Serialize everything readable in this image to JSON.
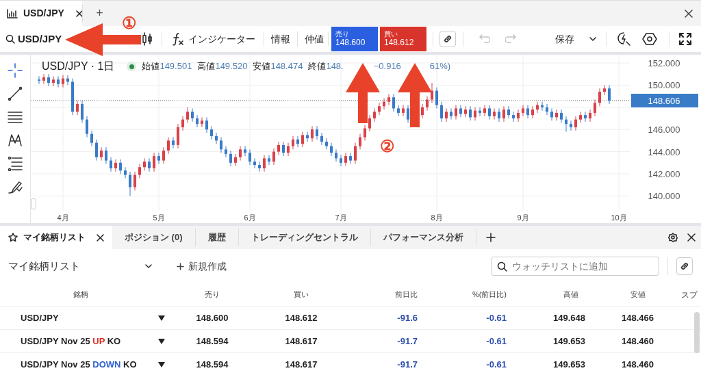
{
  "chart_tabs": [
    {
      "label": "USD/JPY",
      "selected": true
    },
    {
      "label": "+",
      "selected": false
    }
  ],
  "toolbar": {
    "search": "USD/JPY",
    "indicator": "インジケーター",
    "info": "情報",
    "mid": "仲値",
    "sell": {
      "label": "売り",
      "price": "148.600"
    },
    "buy": {
      "label": "買い",
      "price": "148.612"
    },
    "undo_disabled": true,
    "redo_disabled": true,
    "save": "保存"
  },
  "chart": {
    "title": "USD/JPY · 1日",
    "live": true,
    "ohlc": [
      {
        "label": "始値",
        "value": "149.501"
      },
      {
        "label": "高値",
        "value": "149.520"
      },
      {
        "label": "安値",
        "value": "148.474"
      },
      {
        "label": "終値",
        "value": "148."
      }
    ],
    "change": "−0.916",
    "change_pct": "61%)",
    "chart_data": {
      "type": "candlestick",
      "categories": [
        null,
        null,
        null,
        null,
        null,
        "4月",
        null,
        null,
        null,
        null,
        null,
        null,
        null,
        null,
        null,
        null,
        null,
        null,
        null,
        null,
        null,
        null,
        null,
        null,
        null,
        "5月",
        null,
        null,
        null,
        null,
        null,
        null,
        null,
        null,
        null,
        null,
        null,
        null,
        null,
        null,
        null,
        null,
        null,
        null,
        "6月",
        null,
        null,
        null,
        null,
        null,
        null,
        null,
        null,
        null,
        null,
        null,
        null,
        null,
        null,
        null,
        null,
        null,
        null,
        "7月",
        null,
        null,
        null,
        null,
        null,
        null,
        null,
        null,
        null,
        null,
        null,
        null,
        null,
        null,
        null,
        null,
        null,
        null,
        null,
        "8月",
        null,
        null,
        null,
        null,
        null,
        null,
        null,
        null,
        null,
        null,
        null,
        null,
        null,
        null,
        null,
        null,
        null,
        "9月",
        null,
        null,
        null,
        null,
        null,
        null,
        null,
        null,
        null,
        null,
        null,
        null,
        null,
        null,
        null,
        null,
        null,
        null,
        null,
        "10月"
      ],
      "ohlc": [
        [
          150.5,
          150.8,
          150.1,
          150.4
        ],
        [
          150.4,
          151.0,
          150.1,
          150.7
        ],
        [
          150.7,
          151.0,
          149.9,
          150.2
        ],
        [
          150.2,
          150.8,
          149.9,
          150.5
        ],
        [
          150.5,
          150.8,
          149.8,
          150.1
        ],
        [
          150.1,
          150.9,
          149.8,
          150.6
        ],
        [
          150.6,
          150.9,
          150.0,
          150.3
        ],
        [
          150.3,
          150.6,
          147.3,
          147.6
        ],
        [
          147.6,
          148.6,
          147.3,
          148.3
        ],
        [
          148.3,
          148.6,
          146.6,
          146.9
        ],
        [
          146.9,
          147.2,
          145.3,
          145.6
        ],
        [
          145.6,
          145.9,
          144.5,
          144.8
        ],
        [
          144.8,
          145.1,
          143.2,
          143.5
        ],
        [
          143.5,
          144.4,
          143.2,
          144.1
        ],
        [
          144.1,
          144.4,
          142.9,
          143.2
        ],
        [
          143.2,
          143.5,
          142.2,
          142.5
        ],
        [
          142.5,
          143.3,
          142.2,
          143.0
        ],
        [
          143.0,
          143.3,
          142.0,
          142.3
        ],
        [
          142.3,
          142.6,
          141.6,
          141.9
        ],
        [
          141.9,
          142.2,
          140.0,
          140.8
        ],
        [
          140.8,
          142.2,
          140.5,
          141.9
        ],
        [
          141.9,
          142.9,
          141.6,
          142.6
        ],
        [
          142.6,
          143.4,
          142.3,
          143.1
        ],
        [
          143.1,
          143.4,
          142.2,
          142.5
        ],
        [
          142.5,
          143.9,
          142.2,
          143.6
        ],
        [
          143.6,
          143.9,
          142.9,
          143.2
        ],
        [
          143.2,
          144.4,
          142.9,
          144.1
        ],
        [
          144.1,
          145.3,
          143.8,
          145.0
        ],
        [
          145.0,
          145.3,
          144.3,
          144.6
        ],
        [
          144.6,
          146.5,
          144.3,
          146.2
        ],
        [
          146.2,
          147.2,
          145.9,
          146.9
        ],
        [
          146.9,
          148.0,
          146.6,
          147.6
        ],
        [
          147.6,
          147.9,
          146.7,
          147.0
        ],
        [
          147.0,
          147.3,
          146.2,
          146.5
        ],
        [
          146.5,
          147.1,
          146.2,
          146.8
        ],
        [
          146.8,
          147.1,
          145.7,
          146.0
        ],
        [
          146.0,
          146.3,
          145.1,
          145.4
        ],
        [
          145.4,
          145.7,
          144.7,
          145.0
        ],
        [
          145.0,
          145.3,
          143.9,
          144.2
        ],
        [
          144.2,
          144.5,
          143.5,
          143.8
        ],
        [
          143.8,
          144.1,
          142.7,
          143.0
        ],
        [
          143.0,
          143.8,
          142.7,
          143.5
        ],
        [
          143.5,
          144.5,
          143.2,
          144.2
        ],
        [
          144.2,
          144.5,
          143.6,
          143.9
        ],
        [
          143.9,
          144.2,
          142.8,
          143.1
        ],
        [
          143.1,
          143.4,
          142.5,
          142.8
        ],
        [
          142.8,
          143.1,
          142.2,
          142.5
        ],
        [
          142.5,
          143.7,
          142.2,
          143.4
        ],
        [
          143.4,
          143.7,
          142.8,
          143.1
        ],
        [
          143.1,
          144.3,
          142.8,
          144.0
        ],
        [
          144.0,
          144.9,
          143.7,
          144.6
        ],
        [
          144.6,
          144.9,
          143.6,
          143.9
        ],
        [
          143.9,
          144.8,
          143.6,
          144.5
        ],
        [
          144.5,
          145.4,
          144.2,
          145.1
        ],
        [
          145.1,
          145.4,
          144.4,
          144.7
        ],
        [
          144.7,
          145.8,
          144.4,
          145.5
        ],
        [
          145.5,
          145.8,
          144.9,
          145.2
        ],
        [
          145.2,
          146.3,
          144.9,
          146.0
        ],
        [
          146.0,
          146.3,
          145.1,
          145.4
        ],
        [
          145.4,
          145.7,
          144.6,
          144.9
        ],
        [
          144.9,
          145.2,
          144.2,
          144.5
        ],
        [
          144.5,
          144.8,
          143.6,
          143.9
        ],
        [
          143.9,
          144.2,
          143.1,
          143.4
        ],
        [
          143.4,
          143.7,
          142.7,
          143.0
        ],
        [
          143.0,
          143.9,
          142.7,
          143.6
        ],
        [
          143.6,
          143.9,
          142.9,
          143.2
        ],
        [
          143.2,
          144.8,
          142.9,
          144.5
        ],
        [
          144.5,
          145.6,
          144.2,
          145.3
        ],
        [
          145.3,
          146.4,
          145.0,
          146.1
        ],
        [
          146.1,
          147.3,
          145.8,
          147.0
        ],
        [
          147.0,
          147.9,
          146.7,
          147.6
        ],
        [
          147.6,
          148.4,
          147.3,
          148.1
        ],
        [
          148.1,
          148.8,
          147.8,
          148.5
        ],
        [
          148.5,
          149.2,
          148.2,
          148.9
        ],
        [
          148.9,
          149.2,
          147.6,
          147.9
        ],
        [
          147.9,
          148.2,
          147.2,
          147.5
        ],
        [
          147.5,
          148.2,
          147.2,
          147.9
        ],
        [
          147.9,
          148.2,
          146.6,
          146.9
        ],
        null,
        null,
        [
          147.3,
          148.3,
          147.0,
          148.0
        ],
        [
          148.0,
          149.0,
          147.7,
          148.7
        ],
        [
          148.7,
          150.2,
          148.4,
          149.5
        ],
        [
          149.5,
          149.8,
          147.9,
          148.2
        ],
        [
          148.2,
          148.5,
          146.7,
          147.0
        ],
        [
          147.0,
          147.9,
          146.7,
          147.6
        ],
        [
          147.6,
          147.9,
          146.9,
          147.2
        ],
        [
          147.2,
          148.2,
          146.9,
          147.9
        ],
        [
          147.9,
          148.2,
          147.1,
          147.4
        ],
        [
          147.4,
          148.1,
          147.1,
          147.8
        ],
        [
          147.8,
          148.1,
          146.8,
          147.1
        ],
        [
          147.1,
          148.0,
          146.8,
          147.7
        ],
        [
          147.7,
          148.0,
          147.2,
          147.5
        ],
        [
          147.5,
          148.2,
          147.2,
          147.9
        ],
        [
          147.9,
          148.2,
          146.9,
          147.2
        ],
        [
          147.2,
          147.9,
          146.9,
          147.6
        ],
        [
          147.6,
          147.9,
          146.7,
          147.0
        ],
        [
          147.0,
          148.1,
          146.7,
          147.8
        ],
        [
          147.8,
          148.1,
          147.0,
          147.3
        ],
        [
          147.3,
          147.6,
          146.7,
          147.0
        ],
        [
          147.0,
          147.8,
          146.7,
          147.5
        ],
        [
          147.5,
          148.2,
          147.2,
          147.9
        ],
        [
          147.9,
          148.2,
          147.0,
          147.3
        ],
        [
          147.3,
          148.1,
          147.0,
          147.8
        ],
        [
          147.8,
          148.5,
          147.5,
          148.2
        ],
        [
          148.2,
          148.5,
          147.7,
          148.0
        ],
        [
          148.0,
          148.3,
          147.3,
          147.6
        ],
        [
          147.6,
          147.9,
          146.8,
          147.1
        ],
        [
          147.1,
          147.8,
          146.8,
          147.5
        ],
        [
          147.5,
          147.8,
          146.6,
          146.9
        ],
        [
          146.9,
          147.2,
          145.8,
          146.5
        ],
        [
          146.5,
          146.8,
          145.9,
          146.2
        ],
        [
          146.2,
          147.2,
          145.9,
          146.9
        ],
        [
          146.9,
          147.6,
          146.6,
          147.3
        ],
        [
          147.3,
          147.6,
          146.7,
          147.0
        ],
        [
          147.0,
          147.8,
          146.7,
          147.5
        ],
        [
          147.5,
          148.7,
          147.2,
          148.4
        ],
        [
          148.4,
          149.7,
          148.1,
          149.4
        ],
        [
          149.4,
          150.0,
          149.1,
          149.7
        ],
        [
          149.7,
          150.0,
          148.3,
          148.6
        ],
        null,
        null
      ],
      "grid": true,
      "ref_lines": [
        {
          "axis": "y",
          "value": 148.606,
          "label": "148.606"
        }
      ],
      "ylim": [
        138.67,
        152.74
      ],
      "yticks": [
        {
          "value": 152,
          "label": "152.000"
        },
        {
          "value": 150,
          "label": "150.000"
        },
        {
          "value": 146,
          "label": "146.000"
        },
        {
          "value": 144,
          "label": "144.000"
        },
        {
          "value": 142,
          "label": "142.000"
        },
        {
          "value": 140,
          "label": "140.000"
        }
      ]
    }
  },
  "annotations": [
    "①",
    "②"
  ],
  "bottom_tabs": [
    {
      "label": "マイ銘柄リスト",
      "selected": true
    },
    {
      "label": "ポジション (0)",
      "selected": false
    },
    {
      "label": "履歴",
      "selected": false
    },
    {
      "label": "トレーディングセントラル",
      "selected": false
    },
    {
      "label": "パフォーマンス分析",
      "selected": false
    }
  ],
  "watchlist": {
    "name": "マイ銘柄リスト",
    "new": "新規作成",
    "search_placeholder": "ウォッチリストに追加"
  },
  "table": {
    "columns": [
      "銘柄",
      "売り",
      "買い",
      "前日比",
      "%(前日比)",
      "高値",
      "安値",
      "スプ"
    ],
    "rows": [
      {
        "name": "USD/JPY",
        "sell": "148.600",
        "buy": "148.612",
        "change": "-91.6",
        "pct": "-0.61",
        "high": "149.648",
        "low": "148.466"
      },
      {
        "name": "USD/JPY Nov 25",
        "tag": {
          "text": "UP",
          "color": "#d93025"
        },
        "suffix": "KO",
        "sell": "148.594",
        "buy": "148.617",
        "change": "-91.7",
        "pct": "-0.61",
        "high": "149.653",
        "low": "148.460"
      },
      {
        "name": "USD/JPY Nov 25",
        "tag": {
          "text": "DOWN",
          "color": "#2f5fd0"
        },
        "suffix": "KO",
        "sell": "148.594",
        "buy": "148.617",
        "change": "-91.7",
        "pct": "-0.61",
        "high": "149.653",
        "low": "148.460"
      }
    ]
  }
}
